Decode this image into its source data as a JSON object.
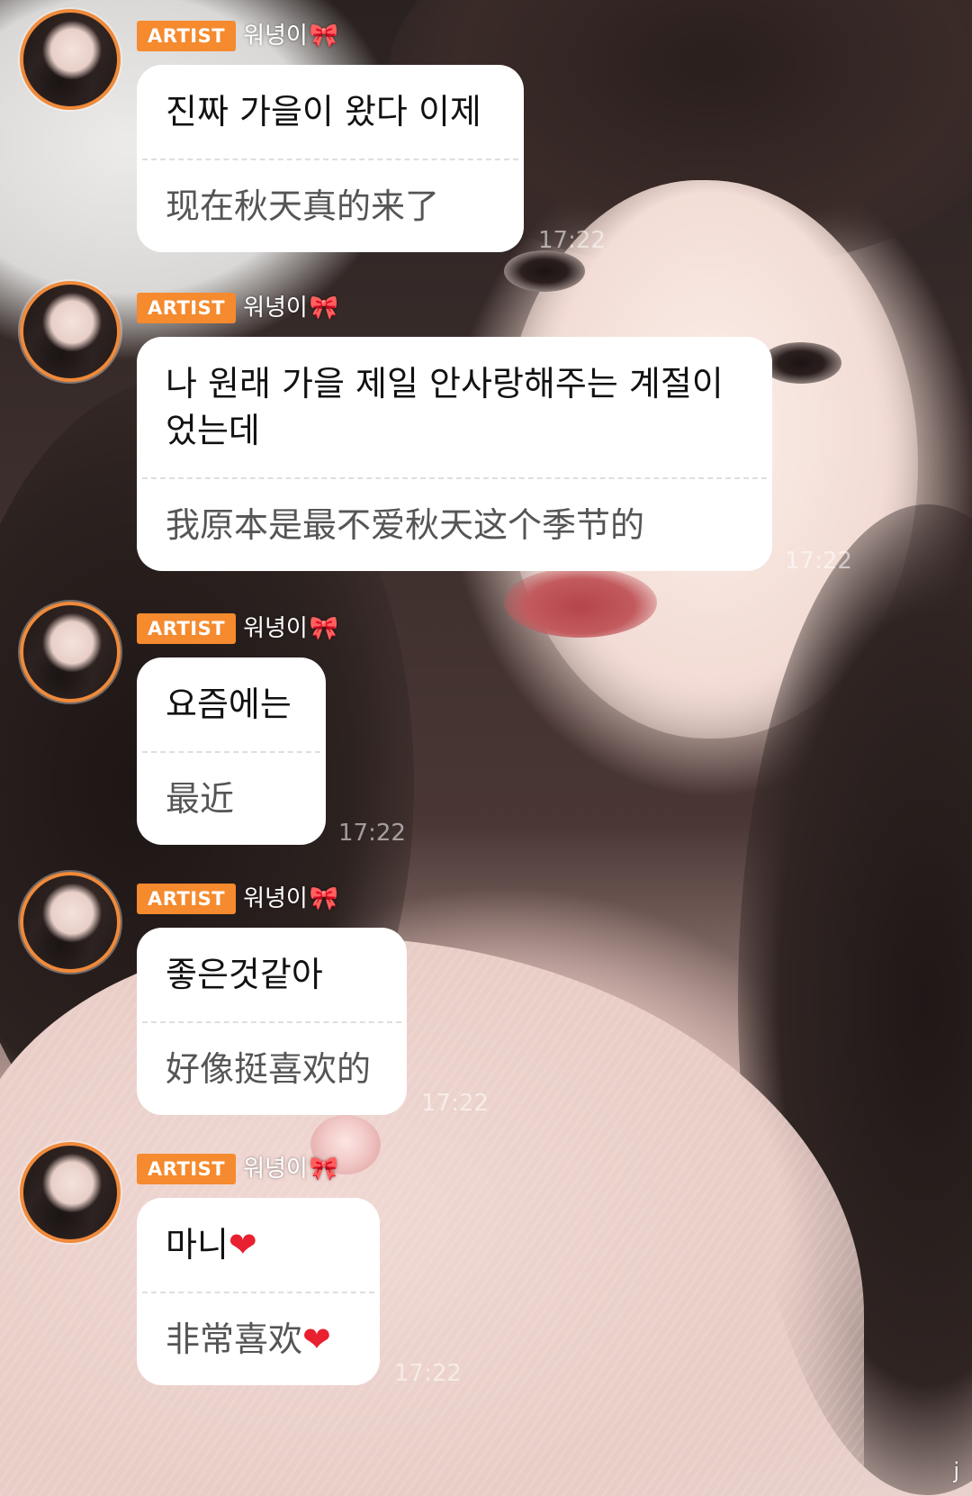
{
  "messages": [
    {
      "badge": "ARTIST",
      "author": "워녕이",
      "author_emoji": "🎀",
      "original": "진짜 가을이 왔다 이제",
      "translation": "现在秋天真的来了",
      "time": "17:22"
    },
    {
      "badge": "ARTIST",
      "author": "워녕이",
      "author_emoji": "🎀",
      "original": "나 원래 가을 제일 안사랑해주는 계절이었는데",
      "translation": "我原本是最不爱秋天这个季节的",
      "time": "17:22"
    },
    {
      "badge": "ARTIST",
      "author": "워녕이",
      "author_emoji": "🎀",
      "original": "요즘에는",
      "translation": "最近",
      "time": "17:22"
    },
    {
      "badge": "ARTIST",
      "author": "워녕이",
      "author_emoji": "🎀",
      "original": "좋은것같아",
      "translation": "好像挺喜欢的",
      "time": "17:22"
    },
    {
      "badge": "ARTIST",
      "author": "워녕이",
      "author_emoji": "🎀",
      "original": "마니",
      "original_emoji": "❤",
      "translation": "非常喜欢",
      "translation_emoji": "❤",
      "time": "17:22"
    }
  ],
  "watermark": "j"
}
